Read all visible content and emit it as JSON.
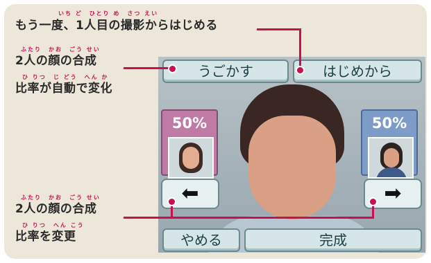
{
  "annotations": {
    "top": {
      "text": "もう一度、1人目の撮影からはじめる",
      "ruby": "いち ど　ひとり め　さつ えい"
    },
    "blend_auto_line1": {
      "text": "2人の顔の合成",
      "ruby": "ふたり　かお　ごう せい"
    },
    "blend_auto_line2": {
      "text": "比率が自動で変化",
      "ruby": "ひ りつ　じ どう　へん か"
    },
    "blend_change_line1": {
      "text": "2人の顔の合成",
      "ruby": "ふたり　かお　ごう せい"
    },
    "blend_change_line2": {
      "text": "比率を変更",
      "ruby": "ひ りつ　へん こう"
    }
  },
  "screen": {
    "buttons": {
      "move": "うごかす",
      "restart": "はじめから",
      "quit": "やめる",
      "done": "完成"
    },
    "left_ratio": "50%",
    "right_ratio": "50%",
    "left_arrow": "⬅",
    "right_arrow": "➡"
  },
  "colors": {
    "accent": "#c8104e",
    "left_panel": "#c07aa6",
    "right_panel": "#7e9cc8",
    "button_text": "#1c3f44"
  },
  "icons": [
    "left-arrow-icon",
    "right-arrow-icon"
  ]
}
